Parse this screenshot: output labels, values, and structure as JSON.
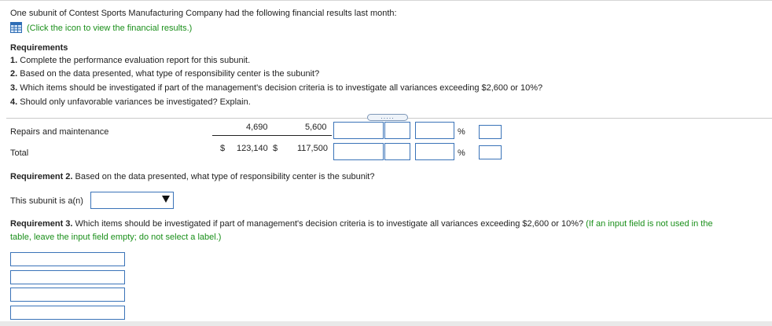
{
  "intro": {
    "text": "One subunit of Contest Sports Manufacturing Company had the following financial results last month:",
    "link_text": "(Click the icon to view the financial results.)"
  },
  "requirements": {
    "heading": "Requirements",
    "items": [
      {
        "num": "1.",
        "text": "Complete the performance evaluation report for this subunit."
      },
      {
        "num": "2.",
        "text": "Based on the data presented, what type of responsibility center is the subunit?"
      },
      {
        "num": "3.",
        "text": "Which items should be investigated if part of the management's decision criteria is to investigate all variances exceeding $2,600 or 10%?"
      },
      {
        "num": "4.",
        "text": "Should only unfavorable variances be investigated? Explain."
      }
    ]
  },
  "expander": {
    "label": "....."
  },
  "report": {
    "rows": [
      {
        "label": "Repairs and maintenance",
        "dollar1": "",
        "actual": "4,690",
        "dollar2": "",
        "budget": "5,600",
        "pct": "%"
      },
      {
        "label": "Total",
        "dollar1": "$",
        "actual": "123,140",
        "dollar2": "$",
        "budget": "117,500",
        "pct": "%"
      }
    ]
  },
  "req2": {
    "heading": "Requirement 2.",
    "text": " Based on the data presented, what type of responsibility center is the subunit?",
    "prompt": "This subunit is a(n)"
  },
  "req3": {
    "heading": "Requirement 3.",
    "text": " Which items should be investigated if part of management's decision criteria is to investigate all variances exceeding $2,600 or 10%?",
    "hint_line1": "(If an input field is not used in the",
    "hint_line2": "table, leave the input field empty; do not select a label.)"
  },
  "icons": {
    "table_icon": "grid-table-icon",
    "dropdown_arrow": "triangle-down-icon"
  },
  "colors": {
    "link_green": "#1a8f1a",
    "input_border": "#3a73b8"
  }
}
